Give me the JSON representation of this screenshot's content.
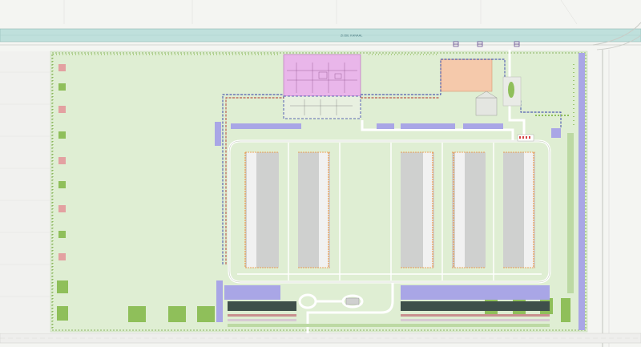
{
  "canal": {
    "label": "ZIJDE KANAAL"
  },
  "colors": {
    "site": "#dfeed3",
    "canal": "#bfe0dc",
    "building": "#cfd0cf",
    "road": "#ffffff",
    "substation": "#e9b6ea",
    "parking": "#f5c9ab",
    "water": "#a9a6e6",
    "hedge": "#8fbf5a",
    "hedge_red": "#e3a1a1",
    "fence": "#6e9e3e",
    "cable_blue": "#2e38a8",
    "cable_red": "#b23227",
    "building_edge": "#f08a2a",
    "solar": "#3e4f4a"
  },
  "legend": []
}
